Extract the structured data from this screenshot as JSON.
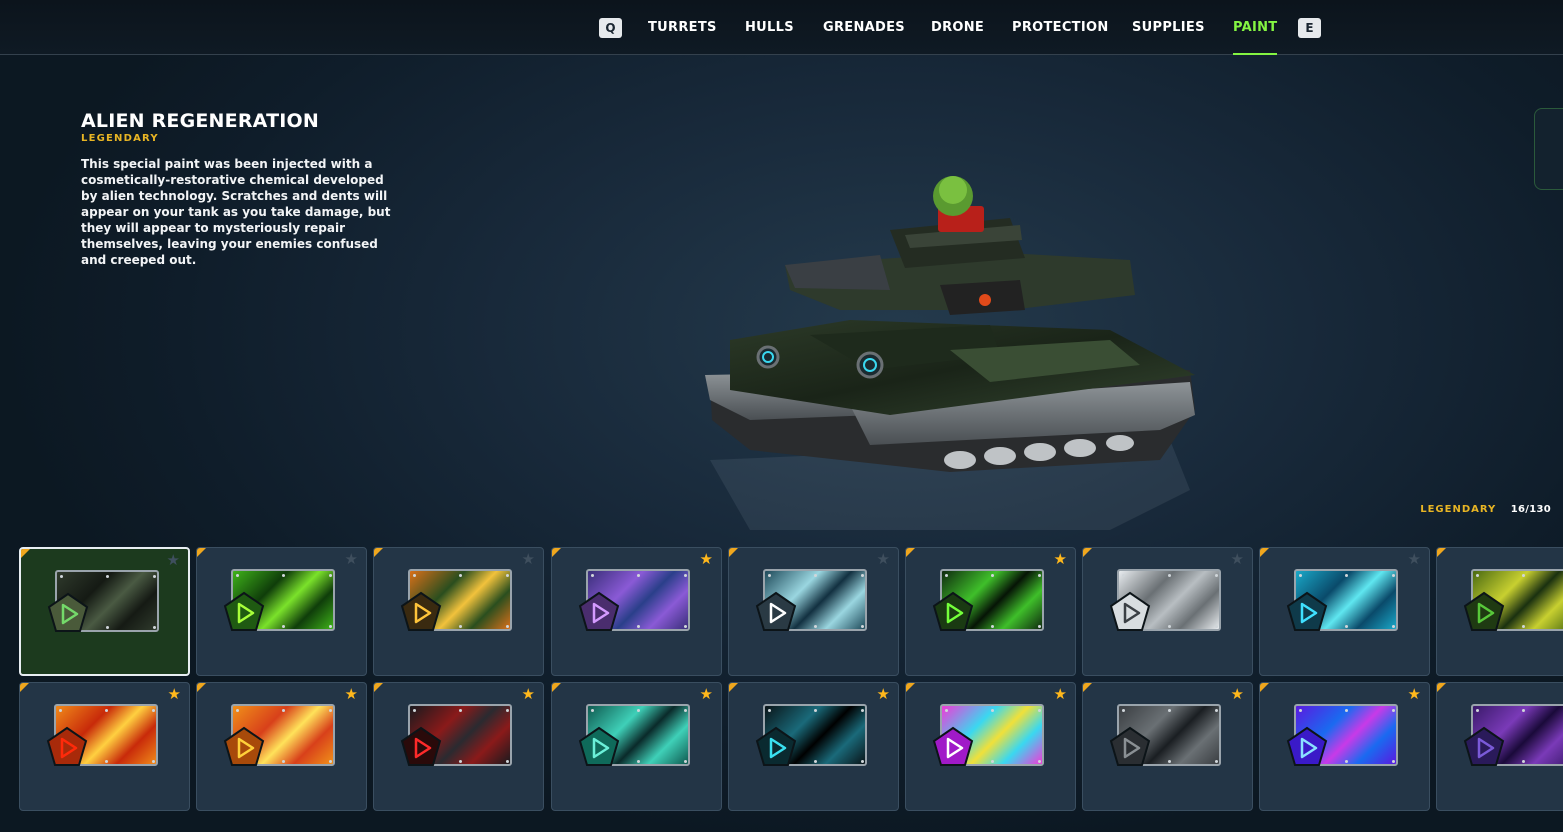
{
  "nav": {
    "prev_key": "Q",
    "next_key": "E",
    "tabs": [
      {
        "label": "TURRETS",
        "active": false
      },
      {
        "label": "HULLS",
        "active": false
      },
      {
        "label": "GRENADES",
        "active": false
      },
      {
        "label": "DRONE",
        "active": false
      },
      {
        "label": "PROTECTION",
        "active": false
      },
      {
        "label": "SUPPLIES",
        "active": false
      },
      {
        "label": "PAINT",
        "active": true
      }
    ]
  },
  "item": {
    "title": "ALIEN REGENERATION",
    "rarity": "LEGENDARY",
    "description": "This special paint was been injected with a cosmetically-restorative chemical developed by alien technology. Scratches and dents will appear on your tank as you take damage, but they will appear to mysteriously repair themselves, leaving your enemies confused and creeped out."
  },
  "collection": {
    "rarity": "LEGENDARY",
    "count": "16/130"
  },
  "colors": {
    "accent_green": "#84f542",
    "legendary_gold": "#e8b524",
    "favorite_star": "#ffb81c",
    "rarity_corner": "#f0a71e"
  },
  "paints": [
    {
      "favorite": false,
      "selected": true,
      "gem": "#4a5a3a",
      "icon": "#74d96a",
      "swatch": [
        "#2f3a2c",
        "#151a14",
        "#4a5a43"
      ]
    },
    {
      "favorite": false,
      "selected": false,
      "gem": "#1f5a12",
      "icon": "#a8ff3a",
      "swatch": [
        "#3fb21a",
        "#0f3d0a",
        "#7be22b"
      ]
    },
    {
      "favorite": false,
      "selected": false,
      "gem": "#3a2a10",
      "icon": "#ffc43a",
      "swatch": [
        "#d8701a",
        "#2a4e1e",
        "#f2c23c"
      ]
    },
    {
      "favorite": true,
      "selected": false,
      "gem": "#4a2d6e",
      "icon": "#d49aff",
      "swatch": [
        "#3a2f7a",
        "#8a5ad6",
        "#2a3f8a"
      ]
    },
    {
      "favorite": false,
      "selected": false,
      "gem": "#2a3a44",
      "icon": "#ffffff",
      "swatch": [
        "#1f4a5a",
        "#9ad6e0",
        "#123040"
      ]
    },
    {
      "favorite": true,
      "selected": false,
      "gem": "#1a3a12",
      "icon": "#74ff3a",
      "swatch": [
        "#0f2a0f",
        "#3fbf2a",
        "#061406"
      ]
    },
    {
      "favorite": false,
      "selected": false,
      "gem": "#d8dde0",
      "icon": "#3a3f44",
      "swatch": [
        "#e8ecef",
        "#6a7074",
        "#b8bec2"
      ]
    },
    {
      "favorite": false,
      "selected": false,
      "gem": "#0f3a4a",
      "icon": "#3fe0ff",
      "swatch": [
        "#1aa8c8",
        "#0a4a6a",
        "#5fe6f0"
      ]
    },
    {
      "favorite": false,
      "selected": false,
      "gem": "#1f3a12",
      "icon": "#58c83a",
      "swatch": [
        "#4a6a12",
        "#c8d030",
        "#1a3010"
      ]
    },
    {
      "favorite": true,
      "selected": false,
      "gem": "#a82a0a",
      "icon": "#ff2a0a",
      "swatch": [
        "#f08a1a",
        "#c82a0a",
        "#ffd040"
      ]
    },
    {
      "favorite": true,
      "selected": false,
      "gem": "#a84a0a",
      "icon": "#ffd03a",
      "swatch": [
        "#f0901a",
        "#d8401a",
        "#ffe25a"
      ]
    },
    {
      "favorite": true,
      "selected": false,
      "gem": "#2a0a0a",
      "icon": "#ff2a2a",
      "swatch": [
        "#1a1a1e",
        "#8a1a1a",
        "#2a2a30"
      ]
    },
    {
      "favorite": true,
      "selected": false,
      "gem": "#0f6a5a",
      "icon": "#6af0d8",
      "swatch": [
        "#0f5a50",
        "#3fd0b8",
        "#0a2a2a"
      ]
    },
    {
      "favorite": true,
      "selected": false,
      "gem": "#0a2a30",
      "icon": "#3ae0f0",
      "swatch": [
        "#0a1418",
        "#1a6a7a",
        "#000000"
      ]
    },
    {
      "favorite": true,
      "selected": false,
      "gem": "#a01ac8",
      "icon": "#ffffff",
      "swatch": [
        "#f03ad8",
        "#3ad8f0",
        "#f0e03a"
      ]
    },
    {
      "favorite": true,
      "selected": false,
      "gem": "#2a2e32",
      "icon": "#8a9094",
      "swatch": [
        "#3a3e42",
        "#6a7074",
        "#1a1e22"
      ]
    },
    {
      "favorite": true,
      "selected": false,
      "gem": "#3a1ac8",
      "icon": "#8ae0ff",
      "swatch": [
        "#5a1ae0",
        "#1a6af0",
        "#c83ae8"
      ]
    },
    {
      "favorite": false,
      "selected": false,
      "gem": "#2a1a5a",
      "icon": "#7a5ad8",
      "swatch": [
        "#3a1a6a",
        "#7a3ab8",
        "#1a0a3a"
      ]
    }
  ]
}
